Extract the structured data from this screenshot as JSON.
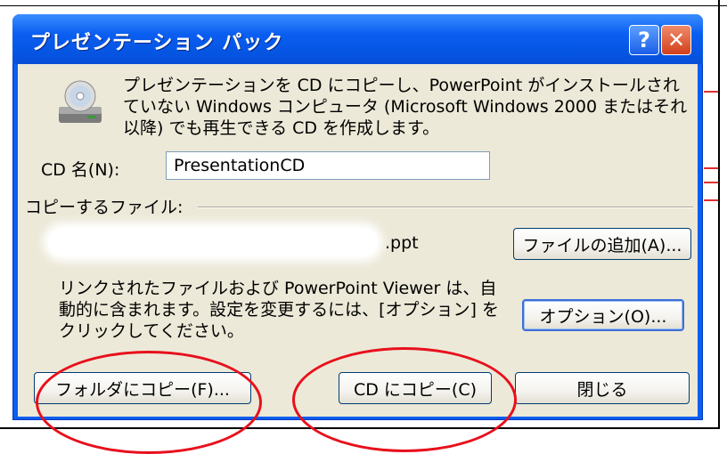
{
  "dialog": {
    "title": "プレゼンテーション パック",
    "help_button": "?",
    "close_button": "✕",
    "intro_text": "プレゼンテーションを CD にコピーし、PowerPoint がインストールされていない Windows コンピュータ (Microsoft Windows 2000 またはそれ以降) でも再生できる CD を作成します。",
    "cd_name_label": "CD 名(N):",
    "cd_name_value": "PresentationCD",
    "files_label": "コピーするファイル:",
    "file_name": ".ppt",
    "add_files_button": "ファイルの追加(A)...",
    "linked_files_text": "リンクされたファイルおよび PowerPoint Viewer は、自動的に含まれます。設定を変更するには、[オプション] をクリックしてください。",
    "options_button": "オプション(O)...",
    "copy_to_folder_button": "フォルダにコピー(F)...",
    "copy_to_cd_button": "CD にコピー(C)",
    "close_dialog_button": "閉じる"
  },
  "colors": {
    "titlebar": "#0a5ef0",
    "client_bg": "#ece9d8",
    "annotation": "#e8101c"
  },
  "annotations": [
    "copy-to-folder-highlight",
    "copy-to-cd-highlight"
  ]
}
